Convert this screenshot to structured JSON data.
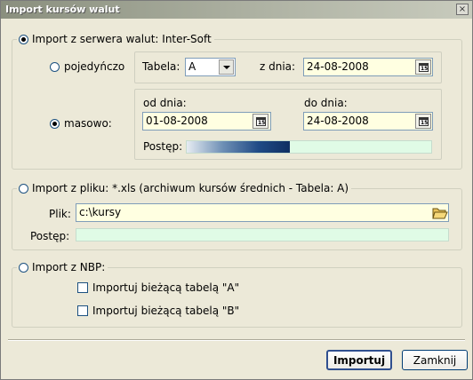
{
  "window": {
    "title": "Import kursów walut",
    "close_glyph": "×"
  },
  "server_section": {
    "label": "Import z serwera walut: Inter-Soft",
    "selected": true,
    "single": {
      "label": "pojedyńczo",
      "selected": false,
      "table_label": "Tabela:",
      "table_value": "A",
      "date_label": "z dnia:",
      "date_value": "24-08-2008"
    },
    "bulk": {
      "label": "masowo:",
      "selected": true,
      "from_label": "od dnia:",
      "from_value": "01-08-2008",
      "to_label": "do dnia:",
      "to_value": "24-08-2008",
      "progress_label": "Postęp:",
      "progress_fraction": 0.42
    }
  },
  "file_section": {
    "label": "Import z pliku: *.xls (archiwum kursów średnich - Tabela: A)",
    "selected": false,
    "file_label": "Plik:",
    "file_value": "c:\\kursy",
    "progress_label": "Postęp:",
    "progress_fraction": 0
  },
  "nbp_section": {
    "label": "Import z NBP:",
    "selected": false,
    "checkbox_a": {
      "label": "Importuj bieżącą tabelą \"A\"",
      "checked": false
    },
    "checkbox_b": {
      "label": "Importuj bieżącą tabelą \"B\"",
      "checked": false
    }
  },
  "buttons": {
    "import_label": "Importuj",
    "close_label": "Zamknij"
  },
  "icons": {
    "calendar": "calendar-icon",
    "dropdown": "chevron-down-icon",
    "folder": "folder-open-icon"
  },
  "calendar_icon_text": "15"
}
